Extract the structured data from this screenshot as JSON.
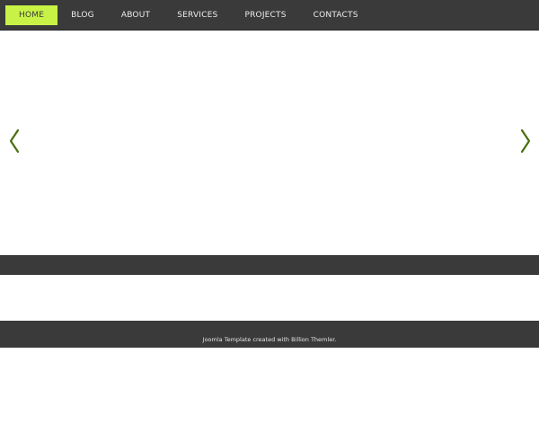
{
  "nav": {
    "items": [
      {
        "label": "HOME",
        "active": true
      },
      {
        "label": "BLOG"
      },
      {
        "label": "ABOUT"
      },
      {
        "label": "SERVICES"
      },
      {
        "label": "PROJECTS"
      },
      {
        "label": "CONTACTS"
      }
    ],
    "active_color": "#c8f346",
    "bar_color": "#3a3a3a"
  },
  "slider": {
    "prev_icon": "chevron-left-icon",
    "next_icon": "chevron-right-icon",
    "arrow_color": "#4a6e10"
  },
  "footer": {
    "credit_text": "Joomla Template created with Billion Themler."
  }
}
